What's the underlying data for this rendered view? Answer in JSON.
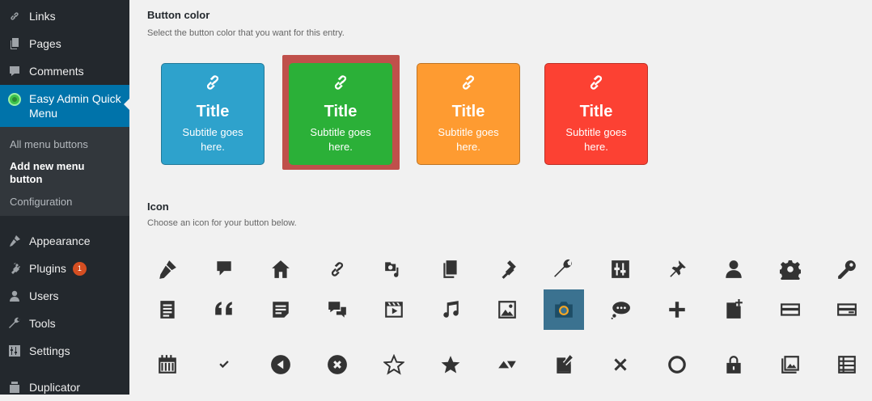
{
  "sidebar": {
    "menu": {
      "links": "Links",
      "pages": "Pages",
      "comments": "Comments",
      "easy_admin": "Easy Admin Quick Menu",
      "appearance": "Appearance",
      "plugins": "Plugins",
      "plugins_badge": "1",
      "users": "Users",
      "tools": "Tools",
      "settings": "Settings",
      "duplicator": "Duplicator"
    },
    "submenu": {
      "all": "All menu buttons",
      "add_new": "Add new menu button",
      "config": "Configuration"
    }
  },
  "button_color": {
    "title": "Button color",
    "description": "Select the button color that you want for this entry.",
    "cards": [
      {
        "title": "Title",
        "subtitle": "Subtitle goes here.",
        "color": "#2ea2cc",
        "selected": false
      },
      {
        "title": "Title",
        "subtitle": "Subtitle goes here.",
        "color": "#2bb038",
        "selected": true
      },
      {
        "title": "Title",
        "subtitle": "Subtitle goes here.",
        "color": "#fe9b31",
        "selected": false
      },
      {
        "title": "Title",
        "subtitle": "Subtitle goes here.",
        "color": "#fc4133",
        "selected": false
      }
    ],
    "selected_frame_color": "#c0504b"
  },
  "icon_section": {
    "title": "Icon",
    "description": "Choose an icon for your button below.",
    "selected_icon": "camera-icon",
    "selected_color": "#3b7290",
    "icons": [
      [
        "paintbrush-icon",
        "comment-icon",
        "home-icon",
        "link-icon",
        "media-icon",
        "copy-icon",
        "plugin-icon",
        "wrench-icon",
        "settings-sliders-icon",
        "pin-icon",
        "user-icon",
        "gear-icon",
        "key-icon"
      ],
      [
        "document-icon",
        "quote-icon",
        "note-icon",
        "chat-icon",
        "video-icon",
        "music-icon",
        "image-icon",
        "camera-icon",
        "speech-bubble-icon",
        "plus-icon",
        "add-page-icon",
        "card-icon",
        "wide-card-icon"
      ],
      [
        "calendar-icon",
        "checkmark-icon",
        "back-icon",
        "close-circle-icon",
        "star-empty-icon",
        "star-filled-icon",
        "triangles-icon",
        "edit-page-icon",
        "close-icon",
        "circle-icon",
        "lock-icon",
        "images-icon",
        "list-icon"
      ]
    ]
  }
}
